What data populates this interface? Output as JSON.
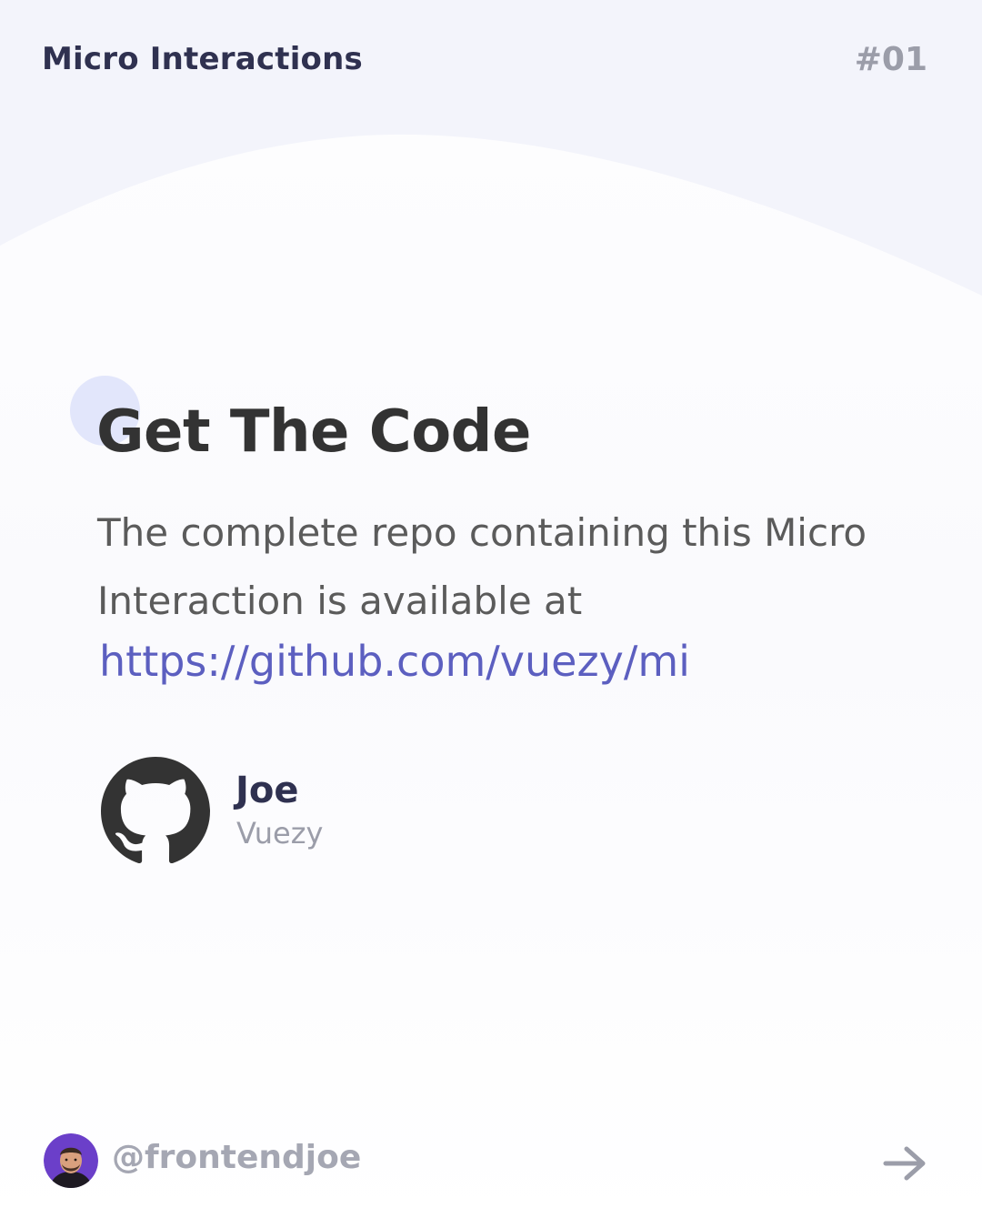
{
  "header": {
    "series_title": "Micro Interactions",
    "episode_number": "#01"
  },
  "content": {
    "heading": "Get The Code",
    "description": "The complete repo containing this Micro Interaction is available at",
    "repo_url": "https://github.com/vuezy/mi"
  },
  "author": {
    "icon": "github-icon",
    "name": "Joe",
    "org": "Vuezy"
  },
  "footer": {
    "avatar_icon": "avatar",
    "handle": "@frontendjoe",
    "next_icon": "arrow-right-icon"
  },
  "colors": {
    "background_top": "#f3f4fb",
    "accent_dot": "#e2e6fb",
    "link": "#5c5fc0",
    "title_text": "#2f3150",
    "muted_text": "#9b9da9",
    "body_text": "#5b5b5b",
    "avatar_ring": "#6b3fc9"
  }
}
